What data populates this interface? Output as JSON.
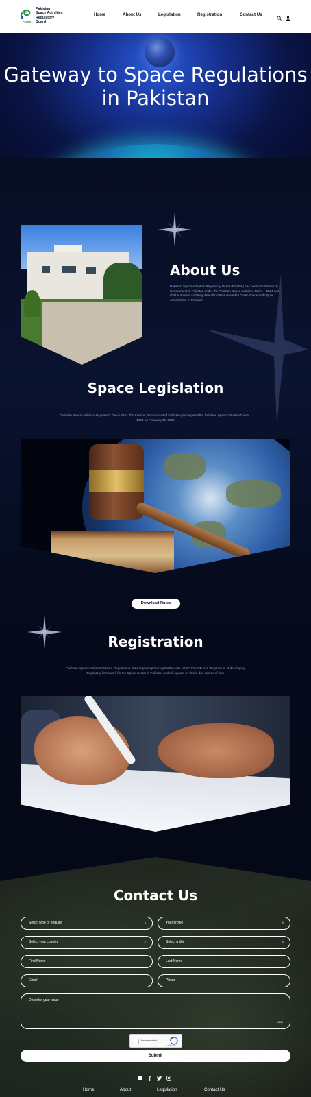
{
  "header": {
    "logo_lines": [
      "Pakistan",
      "Space Activities",
      "Regulatory",
      "Board"
    ],
    "logo_abbr": "PSARB",
    "nav": [
      "Home",
      "About Us",
      "Legislation",
      "Registration",
      "Contact Us"
    ],
    "icons": [
      "search-icon",
      "user-icon"
    ]
  },
  "hero": {
    "title": "Gateway to Space Regulations in Pakistan"
  },
  "about": {
    "title": "About Us",
    "text": "Pakistan Space Activities Regulatory Board (PSARB) has been constituted by Government of Pakistan under the Pakistan Space Activities Rules – 2024 and shall authorize and Regulate all matters related to Outer Space and Upper Atmosphere in Pakistan"
  },
  "legislation": {
    "title": "Space Legislation",
    "text": "Pakistan Space Activities Regulatory Rules 2024 The Federal Government of Pakistan promulgated the Pakistan Space Activities Rules – 2024 on February 02, 2024",
    "button": "Download Rules"
  },
  "registration": {
    "title": "Registration",
    "text": "Pakistan Space Activities Rules & Regulations 2024 requires prior registration with SECP. PSARB is in the process of developing Regulatory framework for the Space Sector in Pakistan and will update on this in due course of time."
  },
  "contact": {
    "title": "Contact Us",
    "enquiry_type": "Select type of enquiry",
    "profile": "Your profile",
    "country": "Select your country",
    "user_title": "Select a title",
    "first_name": "First Name",
    "last_name": "Last Name",
    "email": "Email",
    "phone": "Phone",
    "issue": "Describe your issue",
    "counter": "0/500",
    "captcha_label": "I'm not a robot",
    "captcha_brand": "reCAPTCHA",
    "submit": "Submit"
  },
  "footer": {
    "socials": [
      "youtube-icon",
      "facebook-icon",
      "twitter-icon",
      "instagram-icon"
    ],
    "nav": [
      "Home",
      "About",
      "Legislation",
      "Contact Us"
    ]
  },
  "colors": {
    "brand_green": "#2a8a47",
    "background_dark": "#060a1c",
    "hero_blue": "#16308f"
  }
}
